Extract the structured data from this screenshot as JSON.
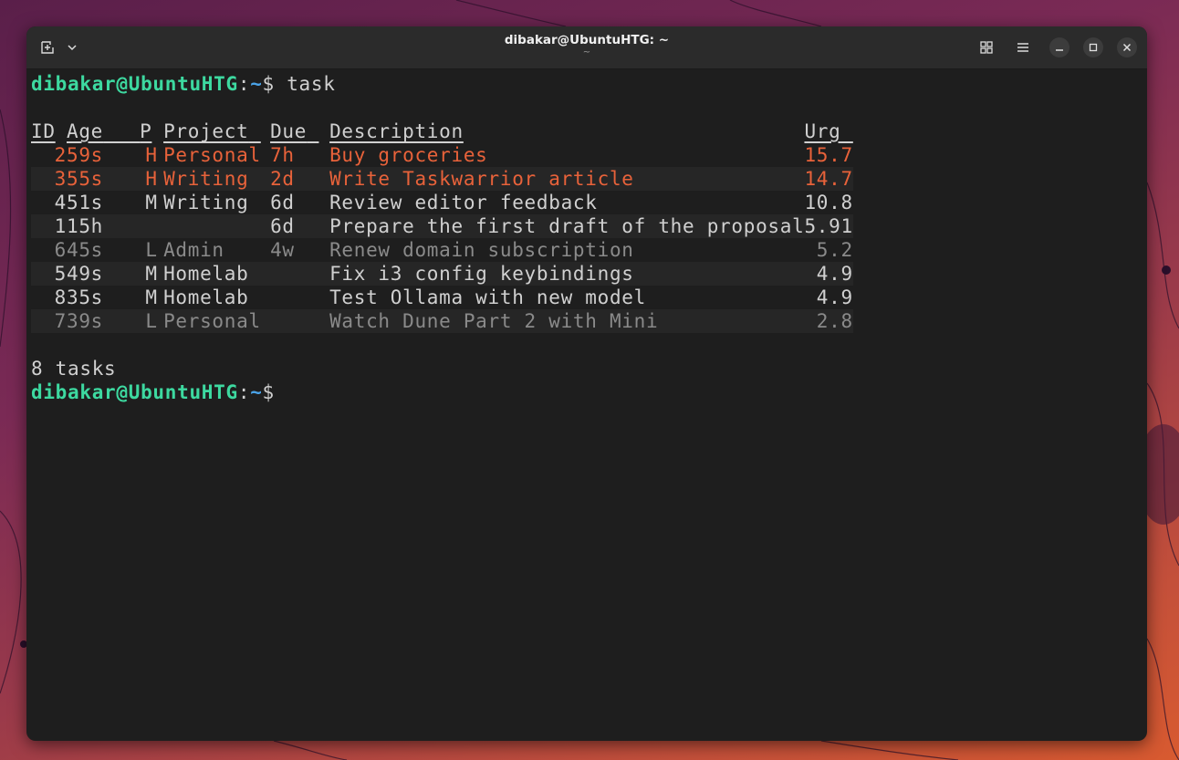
{
  "window": {
    "title": "dibakar@UbuntuHTG: ~",
    "subtitle": "~"
  },
  "prompt": {
    "user_host": "dibakar@UbuntuHTG",
    "colon": ":",
    "path": "~",
    "symbol": "$",
    "command": " task"
  },
  "table": {
    "headers": {
      "id": "ID",
      "age": "Age",
      "priority": "P",
      "project": "Project",
      "due": "Due",
      "description": "Description",
      "urgency": "Urg"
    },
    "rows": [
      {
        "id": "2",
        "age": "59s",
        "priority": "H",
        "project": "Personal",
        "due": "7h",
        "description": "Buy groceries",
        "urgency": "15.7",
        "style": "high"
      },
      {
        "id": "3",
        "age": "55s",
        "priority": "H",
        "project": "Writing",
        "due": "2d",
        "description": "Write Taskwarrior article",
        "urgency": "14.7",
        "style": "high"
      },
      {
        "id": "4",
        "age": "51s",
        "priority": "M",
        "project": "Writing",
        "due": "6d",
        "description": "Review editor feedback",
        "urgency": "10.8",
        "style": "normal"
      },
      {
        "id": "1",
        "age": "15h",
        "priority": "",
        "project": "",
        "due": "6d",
        "description": "Prepare the first draft of the proposal",
        "urgency": "5.91",
        "style": "normal"
      },
      {
        "id": "6",
        "age": "45s",
        "priority": "L",
        "project": "Admin",
        "due": "4w",
        "description": "Renew domain subscription",
        "urgency": "5.2",
        "style": "low"
      },
      {
        "id": "5",
        "age": "49s",
        "priority": "M",
        "project": "Homelab",
        "due": "",
        "description": "Fix i3 config keybindings",
        "urgency": "4.9",
        "style": "normal"
      },
      {
        "id": "8",
        "age": "35s",
        "priority": "M",
        "project": "Homelab",
        "due": "",
        "description": "Test Ollama with new model",
        "urgency": "4.9",
        "style": "normal"
      },
      {
        "id": "7",
        "age": "39s",
        "priority": "L",
        "project": "Personal",
        "due": "",
        "description": "Watch Dune Part 2 with Mini",
        "urgency": "2.8",
        "style": "low"
      }
    ]
  },
  "summary": "8 tasks",
  "colors": {
    "high_priority": "#e8623a",
    "low_priority": "#8a8a8a",
    "prompt_user": "#3dd9a0",
    "prompt_path": "#4aa3e8",
    "terminal_bg": "#1e1e1e"
  },
  "icons": {
    "new_tab": "new-tab-icon",
    "menu_arrow": "chevron-down-icon",
    "grid": "grid-view-icon",
    "hamburger": "hamburger-menu-icon",
    "minimize": "minimize-icon",
    "maximize": "maximize-icon",
    "close": "close-icon"
  }
}
